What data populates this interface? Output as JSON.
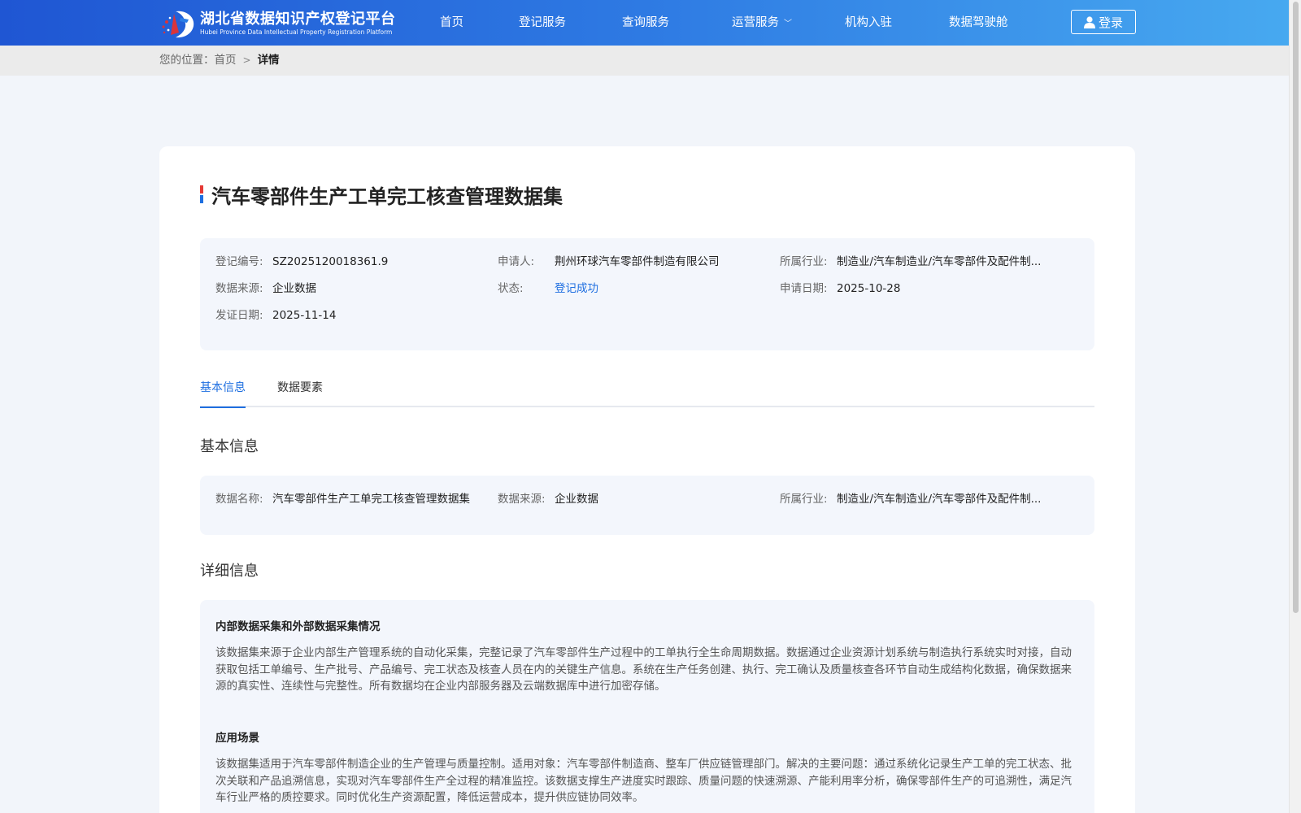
{
  "header": {
    "logo_cn": "湖北省数据知识产权登记平台",
    "logo_en": "Hubei Province Data Intellectual Property Registration Platform",
    "nav": [
      {
        "label": "首页"
      },
      {
        "label": "登记服务"
      },
      {
        "label": "查询服务"
      },
      {
        "label": "运营服务"
      },
      {
        "label": "机构入驻"
      },
      {
        "label": "数据驾驶舱"
      }
    ],
    "login_label": "登录",
    "colors": {
      "gradient_start": "#1f56d3",
      "gradient_end": "#47a9f0"
    }
  },
  "breadcrumb": {
    "prefix": "您的位置：",
    "home": "首页",
    "current": "详情"
  },
  "record": {
    "title": "汽车零部件生产工单完工核查管理数据集",
    "fields": {
      "reg_no": {
        "label": "登记编号:",
        "value": "SZ2025120018361.9"
      },
      "applicant": {
        "label": "申请人:",
        "value": "荆州环球汽车零部件制造有限公司"
      },
      "industry": {
        "label": "所属行业:",
        "value": "制造业/汽车制造业/汽车零部件及配件制..."
      },
      "source": {
        "label": "数据来源:",
        "value": "企业数据"
      },
      "status": {
        "label": "状态:",
        "value": "登记成功"
      },
      "apply_date": {
        "label": "申请日期:",
        "value": "2025-10-28"
      },
      "issue_date": {
        "label": "发证日期:",
        "value": "2025-11-14"
      }
    }
  },
  "tabs": [
    {
      "label": "基本信息",
      "active": true
    },
    {
      "label": "数据要素",
      "active": false
    }
  ],
  "basic": {
    "heading": "基本信息",
    "name": {
      "label": "数据名称:",
      "value": "汽车零部件生产工单完工核查管理数据集"
    },
    "source": {
      "label": "数据来源:",
      "value": "企业数据"
    },
    "industry": {
      "label": "所属行业:",
      "value": "制造业/汽车制造业/汽车零部件及配件制..."
    }
  },
  "detail": {
    "heading": "详细信息",
    "sections": [
      {
        "title": "内部数据采集和外部数据采集情况",
        "text": "该数据集来源于企业内部生产管理系统的自动化采集，完整记录了汽车零部件生产过程中的工单执行全生命周期数据。数据通过企业资源计划系统与制造执行系统实时对接，自动获取包括工单编号、生产批号、产品编号、完工状态及核查人员在内的关键生产信息。系统在生产任务创建、执行、完工确认及质量核查各环节自动生成结构化数据，确保数据来源的真实性、连续性与完整性。所有数据均在企业内部服务器及云端数据库中进行加密存储。"
      },
      {
        "title": "应用场景",
        "text": "该数据集适用于汽车零部件制造企业的生产管理与质量控制。适用对象：汽车零部件制造商、整车厂供应链管理部门。解决的主要问题：通过系统化记录生产工单的完工状态、批次关联和产品追溯信息，实现对汽车零部件生产全过程的精准监控。该数据支撑生产进度实时跟踪、质量问题的快速溯源、产能利用率分析，确保零部件生产的可追溯性，满足汽车行业严格的质控要求。同时优化生产资源配置，降低运营成本，提升供应链协同效率。"
      }
    ]
  }
}
